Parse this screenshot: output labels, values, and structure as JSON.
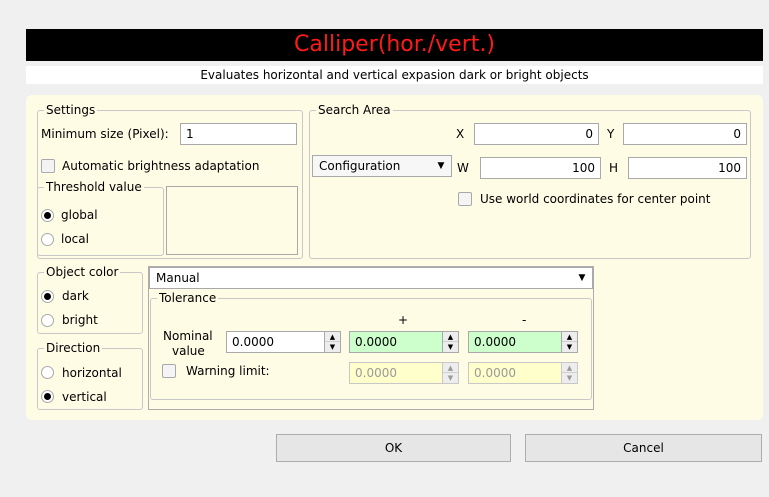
{
  "header": {
    "title": "Calliper(hor./vert.)",
    "subtitle": "Evaluates horizontal and vertical expasion dark or bright objects"
  },
  "settings": {
    "legend": "Settings",
    "min_size_label": "Minimum size (Pixel):",
    "min_size_value": "1",
    "auto_brightness_label": "Automatic brightness adaptation",
    "auto_brightness_checked": false,
    "threshold": {
      "legend": "Threshold value",
      "options": [
        "global",
        "local"
      ],
      "selected": "global"
    }
  },
  "search_area": {
    "legend": "Search Area",
    "x_label": "X",
    "x_value": "0",
    "y_label": "Y",
    "y_value": "0",
    "w_label": "W",
    "w_value": "100",
    "h_label": "H",
    "h_value": "100",
    "config_dropdown": "Configuration",
    "world_coords_label": "Use world coordinates for center point",
    "world_coords_checked": false
  },
  "object_color": {
    "legend": "Object color",
    "options": [
      "dark",
      "bright"
    ],
    "selected": "dark"
  },
  "direction": {
    "legend": "Direction",
    "options": [
      "horizontal",
      "vertical"
    ],
    "selected": "vertical"
  },
  "mode_dropdown": "Manual",
  "tolerance": {
    "legend": "Tolerance",
    "plus_header": "+",
    "minus_header": "-",
    "nominal_label_line1": "Nominal",
    "nominal_label_line2": "value",
    "nominal_value": "0.0000",
    "plus_value": "0.0000",
    "minus_value": "0.0000",
    "warning_label": "Warning limit:",
    "warning_checked": false,
    "warning_plus_value": "0.0000",
    "warning_minus_value": "0.0000"
  },
  "buttons": {
    "ok": "OK",
    "cancel": "Cancel"
  }
}
